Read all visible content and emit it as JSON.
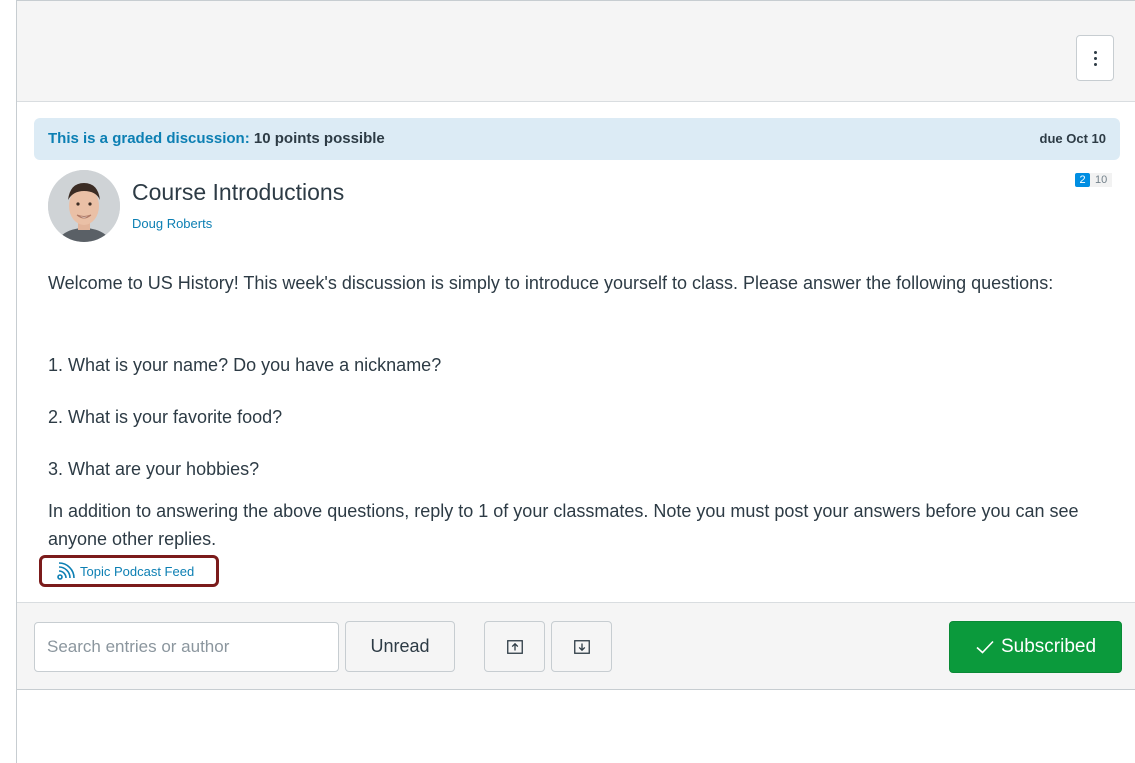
{
  "header": {
    "settings_icon": "kebab-menu-icon"
  },
  "graded_banner": {
    "label": "This is a graded discussion:",
    "points": "10 points possible",
    "due": "due Oct 10"
  },
  "topic": {
    "title": "Course Introductions",
    "author": "Doug Roberts",
    "unread_count": "2",
    "total_count": "10"
  },
  "message": {
    "intro": "Welcome to US History! This week's discussion is simply to introduce yourself to class. Please answer the following questions:",
    "question_1": "1. What is your name? Do you have a nickname?",
    "question_2": "2. What is your favorite food?",
    "question_3": "3. What are your hobbies?",
    "note": "In addition to answering the above questions, reply to 1 of your classmates. Note you must post your answers before you can see anyone other replies."
  },
  "podcast": {
    "label": "Topic Podcast Feed",
    "icon": "rss-feed-icon"
  },
  "toolbar": {
    "search_placeholder": "Search entries or author",
    "search_value": "",
    "unread_label": "Unread",
    "collapse_icon": "collapse-replies-icon",
    "expand_icon": "expand-replies-icon",
    "subscribed_label": "Subscribed",
    "subscribed_icon": "checkmark-icon"
  },
  "colors": {
    "link_blue": "#0c7fb3",
    "banner_bg": "#dcebf5",
    "subscribed_green": "#0b9a3c",
    "highlight_red": "#7b1b1b",
    "unread_badge_blue": "#008ee2"
  }
}
